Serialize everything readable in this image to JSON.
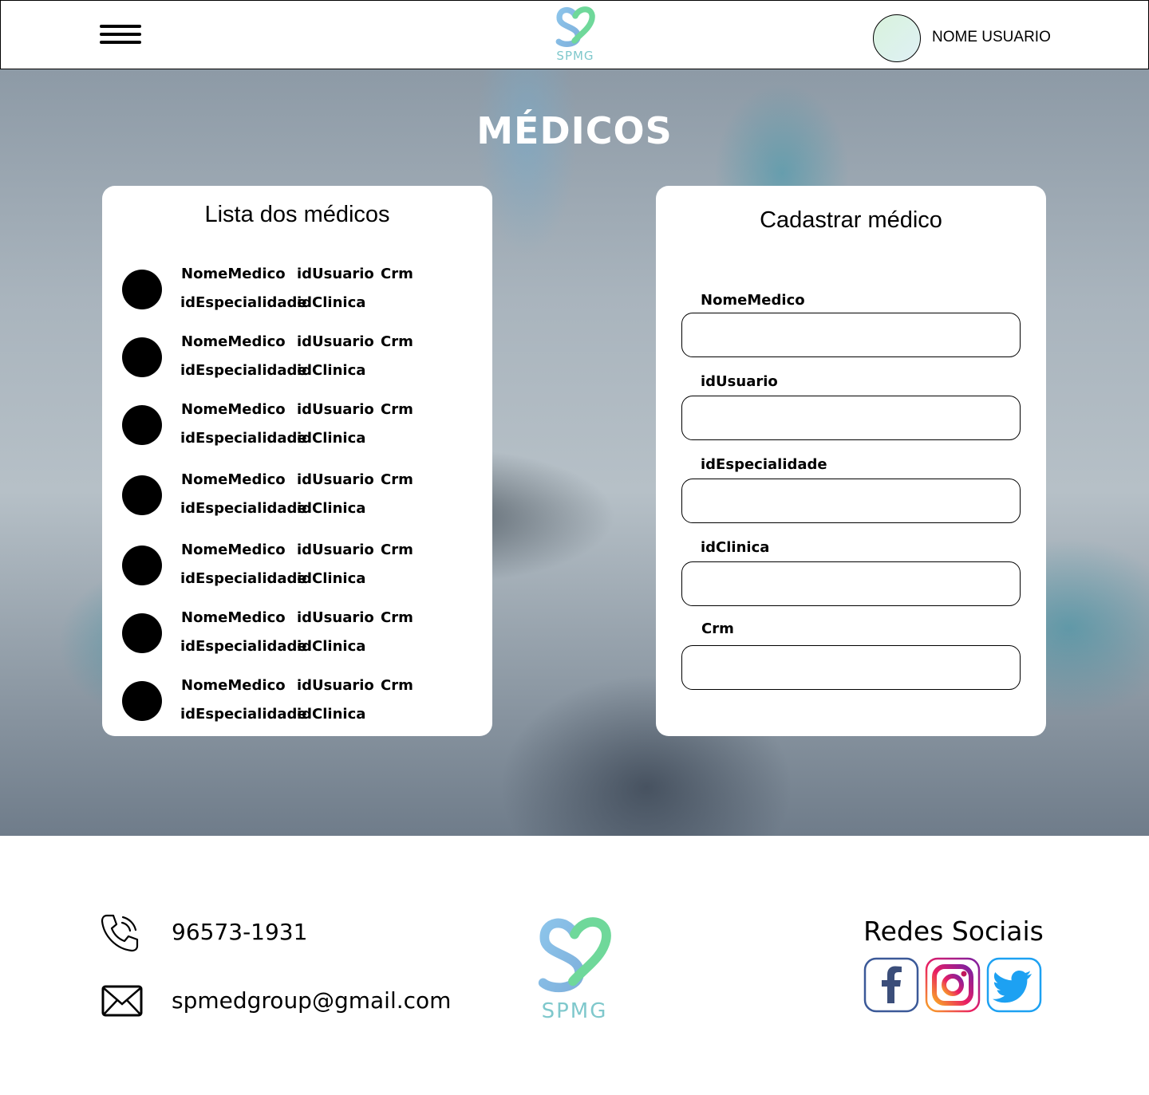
{
  "header": {
    "menu_icon": "hamburger-menu-icon",
    "logo_text": "SPMG",
    "user_name": "NOME USUARIO"
  },
  "hero": {
    "title": "MÉDICOS"
  },
  "doctor_list": {
    "title": "Lista dos médicos",
    "rows": [
      {
        "nome": "NomeMedico",
        "id_usuario": "idUsuario",
        "crm": "Crm",
        "id_especialidade": "idEspecialidade",
        "id_clinica": "idClinica"
      },
      {
        "nome": "NomeMedico",
        "id_usuario": "idUsuario",
        "crm": "Crm",
        "id_especialidade": "idEspecialidade",
        "id_clinica": "idClinica"
      },
      {
        "nome": "NomeMedico",
        "id_usuario": "idUsuario",
        "crm": "Crm",
        "id_especialidade": "idEspecialidade",
        "id_clinica": "idClinica"
      },
      {
        "nome": "NomeMedico",
        "id_usuario": "idUsuario",
        "crm": "Crm",
        "id_especialidade": "idEspecialidade",
        "id_clinica": "idClinica"
      },
      {
        "nome": "NomeMedico",
        "id_usuario": "idUsuario",
        "crm": "Crm",
        "id_especialidade": "idEspecialidade",
        "id_clinica": "idClinica"
      },
      {
        "nome": "NomeMedico",
        "id_usuario": "idUsuario",
        "crm": "Crm",
        "id_especialidade": "idEspecialidade",
        "id_clinica": "idClinica"
      },
      {
        "nome": "NomeMedico",
        "id_usuario": "idUsuario",
        "crm": "Crm",
        "id_especialidade": "idEspecialidade",
        "id_clinica": "idClinica"
      }
    ]
  },
  "form": {
    "title": "Cadastrar médico",
    "fields": [
      {
        "label": "NomeMedico",
        "value": ""
      },
      {
        "label": "idUsuario",
        "value": ""
      },
      {
        "label": "idEspecialidade",
        "value": ""
      },
      {
        "label": "idClinica",
        "value": ""
      },
      {
        "label": "Crm",
        "value": ""
      }
    ]
  },
  "footer": {
    "phone": "96573-1931",
    "email": "spmedgroup@gmail.com",
    "logo_text": "SPMG",
    "social_title": "Redes Sociais",
    "social": [
      "facebook-icon",
      "instagram-icon",
      "twitter-icon"
    ]
  },
  "colors": {
    "logo_blue": "#7fb8e0",
    "logo_green": "#6fd89a",
    "logo_text": "#7fc8cc",
    "avatar_fill": "#dff0ea"
  }
}
